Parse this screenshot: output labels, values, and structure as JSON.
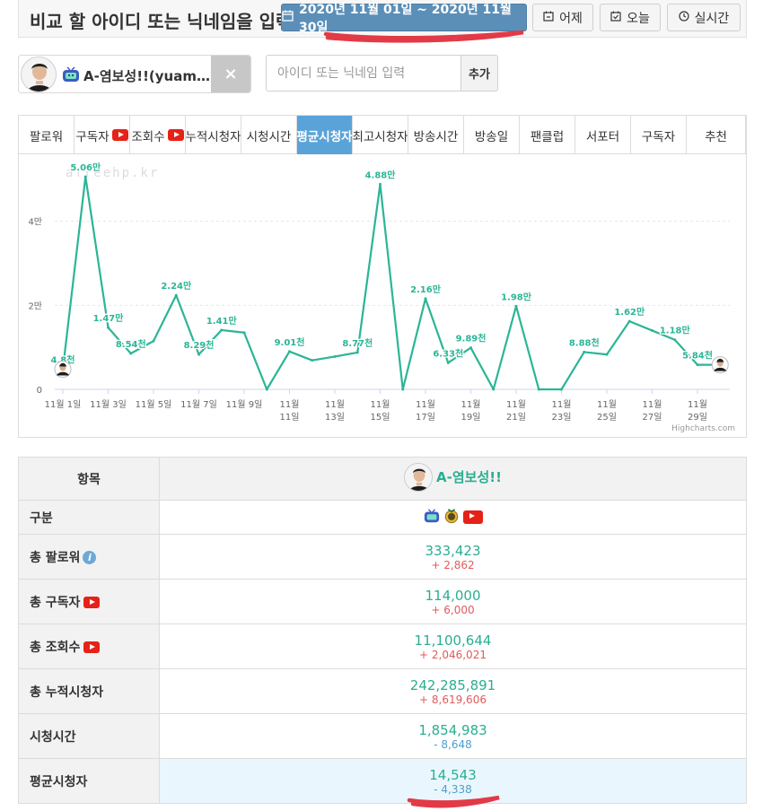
{
  "header": {
    "title": "비교 할 아이디 또는 닉네임을 입력",
    "date_range": "2020년 11월 01일 ~ 2020년 11월 30일",
    "yesterday_label": "어제",
    "today_label": "오늘",
    "realtime_label": "실시간"
  },
  "streamer": {
    "name": "A-염보성!!(yuam…",
    "close_label": "×"
  },
  "search": {
    "placeholder": "아이디 또는 닉네임 입력",
    "add_label": "추가"
  },
  "tabs": [
    {
      "label": "팔로워",
      "yt": false,
      "active": false
    },
    {
      "label": "구독자",
      "yt": true,
      "active": false
    },
    {
      "label": "조회수",
      "yt": true,
      "active": false
    },
    {
      "label": "누적시청자",
      "yt": false,
      "active": false
    },
    {
      "label": "시청시간",
      "yt": false,
      "active": false
    },
    {
      "label": "평균시청자",
      "yt": false,
      "active": true
    },
    {
      "label": "최고시청자",
      "yt": false,
      "active": false
    },
    {
      "label": "방송시간",
      "yt": false,
      "active": false
    },
    {
      "label": "방송일",
      "yt": false,
      "active": false
    },
    {
      "label": "팬클럽",
      "yt": false,
      "active": false
    },
    {
      "label": "서포터",
      "yt": false,
      "active": false
    },
    {
      "label": "구독자",
      "yt": false,
      "active": false
    },
    {
      "label": "추천",
      "yt": false,
      "active": false
    }
  ],
  "chart_data": {
    "type": "line",
    "watermark": "afreehp.kr",
    "credit": "Highcharts.com",
    "ylim": [
      0,
      50600
    ],
    "yticks": [
      {
        "v": 0,
        "label": "0"
      },
      {
        "v": 20000,
        "label": "2만"
      },
      {
        "v": 40000,
        "label": "4만"
      }
    ],
    "xticks": [
      {
        "i": 0,
        "l1": "11월 1일",
        "l2": ""
      },
      {
        "i": 2,
        "l1": "11월 3일",
        "l2": ""
      },
      {
        "i": 4,
        "l1": "11월 5일",
        "l2": ""
      },
      {
        "i": 6,
        "l1": "11월 7일",
        "l2": ""
      },
      {
        "i": 8,
        "l1": "11월 9일",
        "l2": ""
      },
      {
        "i": 10,
        "l1": "11월",
        "l2": "11일"
      },
      {
        "i": 12,
        "l1": "11월",
        "l2": "13일"
      },
      {
        "i": 14,
        "l1": "11월",
        "l2": "15일"
      },
      {
        "i": 16,
        "l1": "11월",
        "l2": "17일"
      },
      {
        "i": 18,
        "l1": "11월",
        "l2": "19일"
      },
      {
        "i": 20,
        "l1": "11월",
        "l2": "21일"
      },
      {
        "i": 22,
        "l1": "11월",
        "l2": "23일"
      },
      {
        "i": 24,
        "l1": "11월",
        "l2": "25일"
      },
      {
        "i": 26,
        "l1": "11월",
        "l2": "27일"
      },
      {
        "i": 28,
        "l1": "11월",
        "l2": "29일"
      }
    ],
    "series": [
      {
        "color": "#2bb596",
        "values": [
          4800,
          50600,
          14700,
          8540,
          11500,
          22400,
          8290,
          14100,
          13500,
          0,
          9010,
          6900,
          7800,
          8770,
          48800,
          0,
          21600,
          6330,
          9890,
          0,
          19800,
          0,
          0,
          8880,
          8300,
          16200,
          14000,
          11800,
          5840,
          5840
        ],
        "labels": [
          {
            "i": 0,
            "text": "4.8천"
          },
          {
            "i": 1,
            "text": "5.06만"
          },
          {
            "i": 2,
            "text": "1.47만"
          },
          {
            "i": 3,
            "text": "8.54천"
          },
          {
            "i": 5,
            "text": "2.24만"
          },
          {
            "i": 6,
            "text": "8.29천"
          },
          {
            "i": 7,
            "text": "1.41만"
          },
          {
            "i": 10,
            "text": "9.01천"
          },
          {
            "i": 13,
            "text": "8.77천"
          },
          {
            "i": 14,
            "text": "4.88만"
          },
          {
            "i": 16,
            "text": "2.16만"
          },
          {
            "i": 17,
            "text": "6.33천"
          },
          {
            "i": 18,
            "text": "9.89천"
          },
          {
            "i": 20,
            "text": "1.98만"
          },
          {
            "i": 23,
            "text": "8.88천"
          },
          {
            "i": 25,
            "text": "1.62만"
          },
          {
            "i": 27,
            "text": "1.18만"
          },
          {
            "i": 28,
            "text": "5.84천"
          }
        ]
      }
    ]
  },
  "table": {
    "col_header": "항목",
    "streamer_name": "A-염보성!!",
    "rows": [
      {
        "label": "구분",
        "kind": "icons"
      },
      {
        "label": "총 팔로워",
        "icon": "info",
        "value": "333,423",
        "delta": "+ 2,862",
        "dir": "up"
      },
      {
        "label": "총 구독자",
        "icon": "yt",
        "value": "114,000",
        "delta": "+ 6,000",
        "dir": "up"
      },
      {
        "label": "총 조회수",
        "icon": "yt",
        "value": "11,100,644",
        "delta": "+ 2,046,021",
        "dir": "up"
      },
      {
        "label": "총 누적시청자",
        "icon": "",
        "value": "242,285,891",
        "delta": "+ 8,619,606",
        "dir": "up"
      },
      {
        "label": "시청시간",
        "icon": "",
        "value": "1,854,983",
        "delta": "- 8,648",
        "dir": "down"
      },
      {
        "label": "평균시청자",
        "icon": "",
        "value": "14,543",
        "delta": "- 4,338",
        "dir": "down"
      }
    ]
  }
}
